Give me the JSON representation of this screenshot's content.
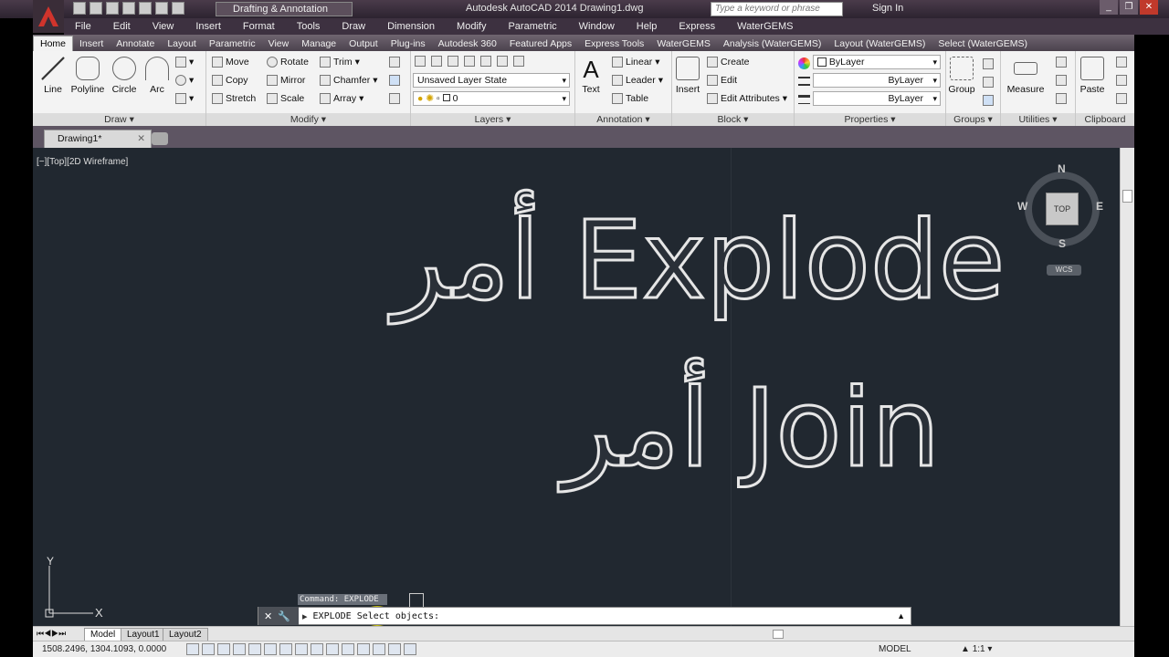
{
  "title_bar": {
    "workspace": "Drafting & Annotation",
    "window_title": "Autodesk AutoCAD 2014    Drawing1.dwg",
    "search_placeholder": "Type a keyword or phrase",
    "sign_in": "Sign In"
  },
  "menu": [
    "File",
    "Edit",
    "View",
    "Insert",
    "Format",
    "Tools",
    "Draw",
    "Dimension",
    "Modify",
    "Parametric",
    "Window",
    "Help",
    "Express",
    "WaterGEMS"
  ],
  "ribbon_tabs": [
    "Home",
    "Insert",
    "Annotate",
    "Layout",
    "Parametric",
    "View",
    "Manage",
    "Output",
    "Plug-ins",
    "Autodesk 360",
    "Featured Apps",
    "Express Tools",
    "WaterGEMS",
    "Analysis (WaterGEMS)",
    "Layout (WaterGEMS)",
    "Select (WaterGEMS)"
  ],
  "draw": {
    "title": "Draw",
    "line": "Line",
    "polyline": "Polyline",
    "circle": "Circle",
    "arc": "Arc"
  },
  "modify": {
    "title": "Modify",
    "move": "Move",
    "rotate": "Rotate",
    "trim": "Trim",
    "copy": "Copy",
    "mirror": "Mirror",
    "chamfer": "Chamfer",
    "stretch": "Stretch",
    "scale": "Scale",
    "array": "Array"
  },
  "layers": {
    "title": "Layers",
    "layer_state": "Unsaved Layer State",
    "current_layer": "0"
  },
  "annotation": {
    "title": "Annotation",
    "text": "Text",
    "linear": "Linear",
    "leader": "Leader",
    "table": "Table"
  },
  "block": {
    "title": "Block",
    "insert": "Insert",
    "create": "Create",
    "edit": "Edit",
    "edit_attributes": "Edit Attributes"
  },
  "properties": {
    "title": "Properties",
    "color": "ByLayer",
    "linetype": "ByLayer",
    "lineweight": "ByLayer"
  },
  "groups": {
    "title": "Groups",
    "group": "Group"
  },
  "utilities": {
    "title": "Utilities",
    "measure": "Measure"
  },
  "clipboard": {
    "title": "Clipboard",
    "paste": "Paste"
  },
  "document": {
    "tab": "Drawing1*",
    "view_label": "[−][Top][2D Wireframe]"
  },
  "canvas_text": {
    "line1": "أمر Explode",
    "line2": "أمر Join"
  },
  "viewcube": {
    "top": "TOP",
    "n": "N",
    "s": "S",
    "e": "E",
    "w": "W",
    "wcs": "WCS"
  },
  "ucs": {
    "y": "Y",
    "x": "X"
  },
  "command": {
    "history": "Command: EXPLODE",
    "current": "EXPLODE Select objects:"
  },
  "layout_tabs": [
    "Model",
    "Layout1",
    "Layout2"
  ],
  "status": {
    "coords": "1508.2496, 1304.1093, 0.0000",
    "model": "MODEL",
    "scale": "1:1"
  }
}
